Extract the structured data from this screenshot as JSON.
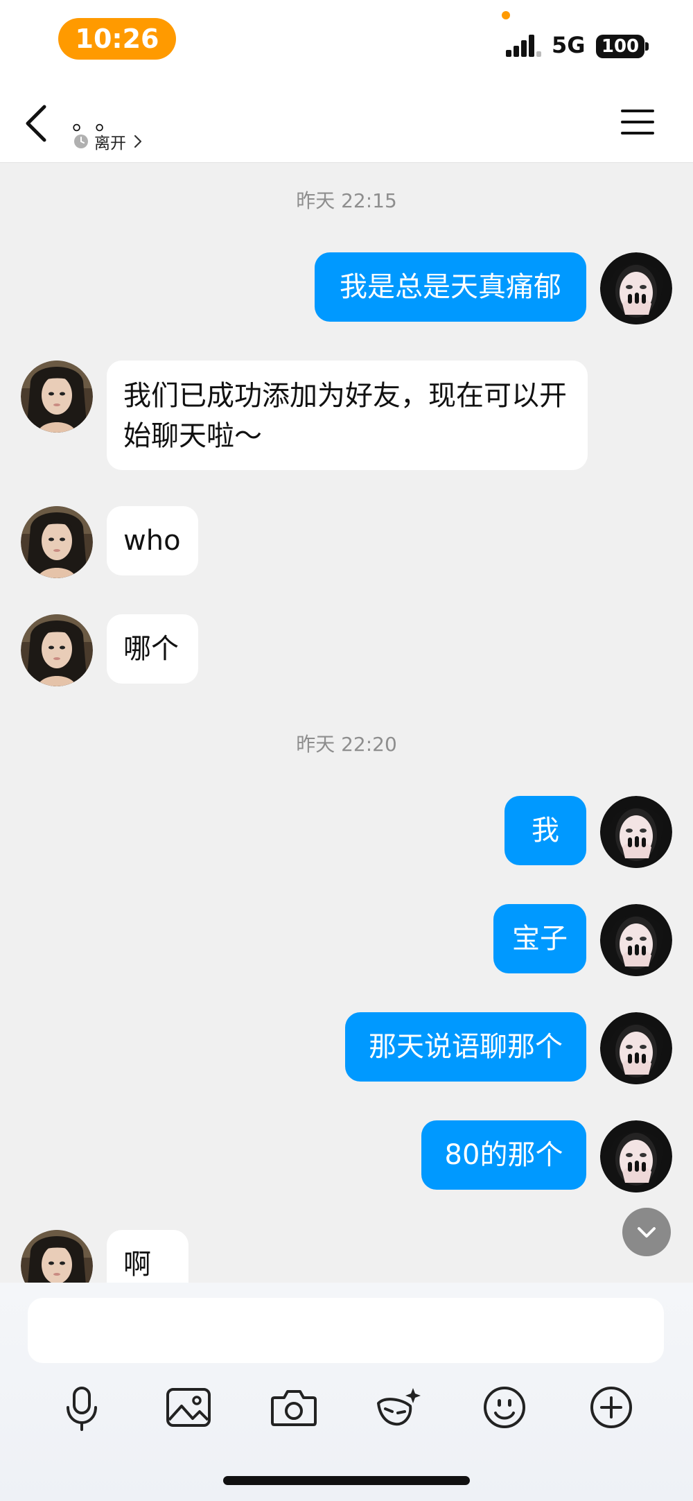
{
  "status_bar": {
    "time": "10:26",
    "network": "5G",
    "battery": "100",
    "accent_color": "#ff9a00"
  },
  "header": {
    "contact_name": "。。",
    "presence": "离开",
    "back_icon": "chevron-left-icon",
    "menu_icon": "hamburger-menu-icon"
  },
  "chat": {
    "outgoing_color": "#0099ff",
    "timestamps": [
      "昨天 22:15",
      "昨天 22:20"
    ],
    "messages": [
      {
        "dir": "out",
        "text": "我是总是天真痛郁"
      },
      {
        "dir": "in",
        "text": "我们已成功添加为好友，现在可以开始聊天啦～"
      },
      {
        "dir": "in",
        "text": "who"
      },
      {
        "dir": "in",
        "text": "哪个"
      },
      {
        "dir": "out",
        "text": "我"
      },
      {
        "dir": "out",
        "text": "宝子"
      },
      {
        "dir": "out",
        "text": "那天说语聊那个"
      },
      {
        "dir": "out",
        "text": "80的那个"
      },
      {
        "dir": "in",
        "text": "啊"
      }
    ]
  },
  "composer": {
    "input_value": "",
    "tools": [
      "microphone-icon",
      "image-icon",
      "camera-icon",
      "ai-mask-icon",
      "emoji-icon",
      "plus-icon"
    ]
  }
}
